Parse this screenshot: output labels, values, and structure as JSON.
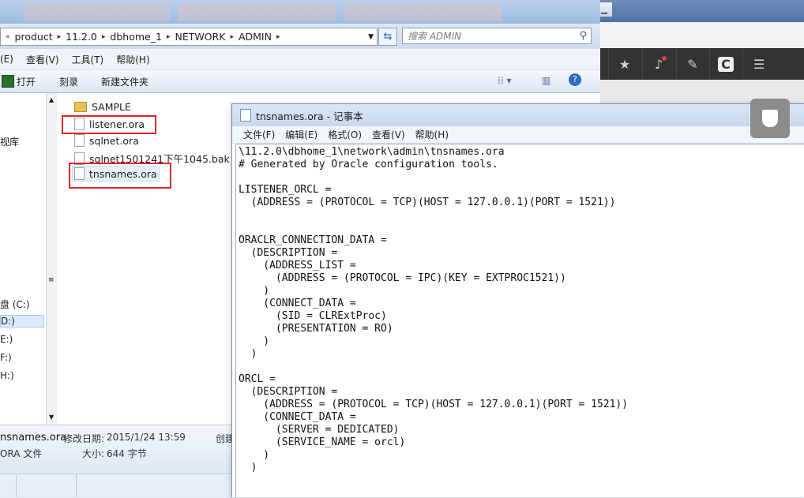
{
  "explorer": {
    "breadcrumb": [
      "product",
      "11.2.0",
      "dbhome_1",
      "NETWORK",
      "ADMIN"
    ],
    "search_placeholder": "搜索 ADMIN",
    "menu": [
      "(E)",
      "查看(V)",
      "工具(T)",
      "帮助(H)"
    ],
    "commands": {
      "open": "打开",
      "burn": "刻录",
      "new_folder": "新建文件夹"
    },
    "nav_items": [
      "视库",
      "盘 (C:)",
      "D:)",
      "E:)",
      "F:)",
      "H:)"
    ],
    "files": [
      "SAMPLE",
      "listener.ora",
      "sqlnet.ora",
      "sqlnet1501241下午1045.bak",
      "tnsnames.ora"
    ],
    "details": {
      "name": "nsnames.ora",
      "modified_label": "修改日期:",
      "modified_value": "2015/1/24 13:59",
      "created_label": "创建",
      "type": "ORA 文件",
      "size_label": "大小:",
      "size_value": "644 字节"
    }
  },
  "notepad": {
    "title": "tnsnames.ora - 记事本",
    "menu": [
      "文件(F)",
      "编辑(E)",
      "格式(O)",
      "查看(V)",
      "帮助(H)"
    ],
    "content": "\\11.2.0\\dbhome_1\\network\\admin\\tnsnames.ora\n# Generated by Oracle configuration tools.\n\nLISTENER_ORCL =\n  (ADDRESS = (PROTOCOL = TCP)(HOST = 127.0.0.1)(PORT = 1521))\n\n\nORACLR_CONNECTION_DATA =\n  (DESCRIPTION =\n    (ADDRESS_LIST =\n      (ADDRESS = (PROTOCOL = IPC)(KEY = EXTPROC1521))\n    )\n    (CONNECT_DATA =\n      (SID = CLRExtProc)\n      (PRESENTATION = RO)\n    )\n  )\n\nORCL =\n  (DESCRIPTION =\n    (ADDRESS = (PROTOCOL = TCP)(HOST = 127.0.0.1)(PORT = 1521))\n    (CONNECT_DATA =\n      (SERVER = DEDICATED)\n      (SERVICE_NAME = orcl)\n    )\n  )"
  },
  "browser": {
    "toolbar_icons": [
      "star-icon",
      "bell-icon",
      "edit-icon",
      "c-logo-icon",
      "menu-icon"
    ],
    "badge_color": "#e0403a"
  },
  "annotation_color": "#e0262a"
}
